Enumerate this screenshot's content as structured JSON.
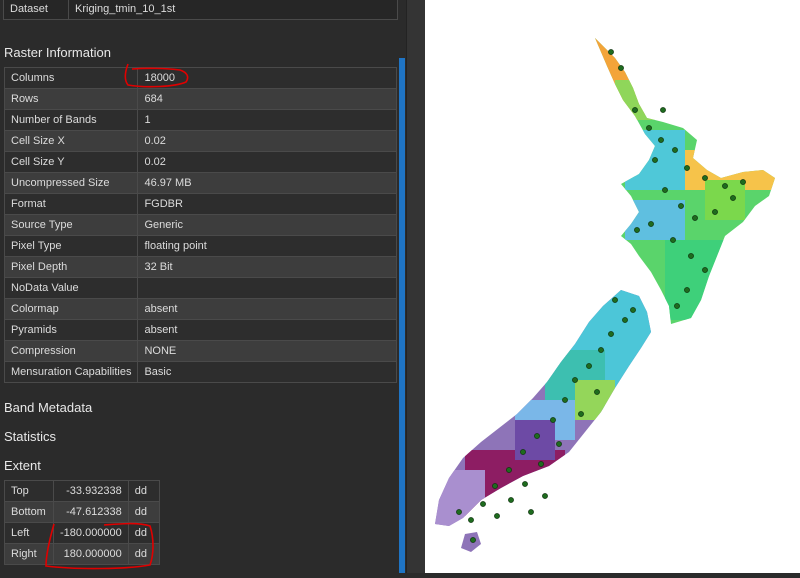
{
  "dataset": {
    "label": "Dataset",
    "value": "Kriging_tmin_10_1st"
  },
  "raster_information": {
    "title": "Raster Information",
    "rows": [
      {
        "label": "Columns",
        "value": "18000"
      },
      {
        "label": "Rows",
        "value": "684"
      },
      {
        "label": "Number of Bands",
        "value": "1"
      },
      {
        "label": "Cell Size X",
        "value": "0.02"
      },
      {
        "label": "Cell Size Y",
        "value": "0.02"
      },
      {
        "label": "Uncompressed Size",
        "value": "46.97 MB"
      },
      {
        "label": "Format",
        "value": "FGDBR"
      },
      {
        "label": "Source Type",
        "value": "Generic"
      },
      {
        "label": "Pixel Type",
        "value": "floating point"
      },
      {
        "label": "Pixel Depth",
        "value": "32 Bit"
      },
      {
        "label": "NoData Value",
        "value": ""
      },
      {
        "label": "Colormap",
        "value": "absent"
      },
      {
        "label": "Pyramids",
        "value": "absent"
      },
      {
        "label": "Compression",
        "value": "NONE"
      },
      {
        "label": "Mensuration Capabilities",
        "value": "Basic"
      }
    ]
  },
  "sections": {
    "band_metadata": "Band Metadata",
    "statistics": "Statistics",
    "extent": "Extent"
  },
  "extent": {
    "rows": [
      {
        "label": "Top",
        "value": "-33.932338",
        "unit": "dd"
      },
      {
        "label": "Bottom",
        "value": "-47.612338",
        "unit": "dd"
      },
      {
        "label": "Left",
        "value": "-180.000000",
        "unit": "dd"
      },
      {
        "label": "Right",
        "value": "180.000000",
        "unit": "dd"
      }
    ]
  },
  "colors": {
    "highlight_circle": "#e00000",
    "scroll_thumb": "#1f74c4"
  },
  "map": {
    "description_icon": "new-zealand-raster-map-icon"
  }
}
